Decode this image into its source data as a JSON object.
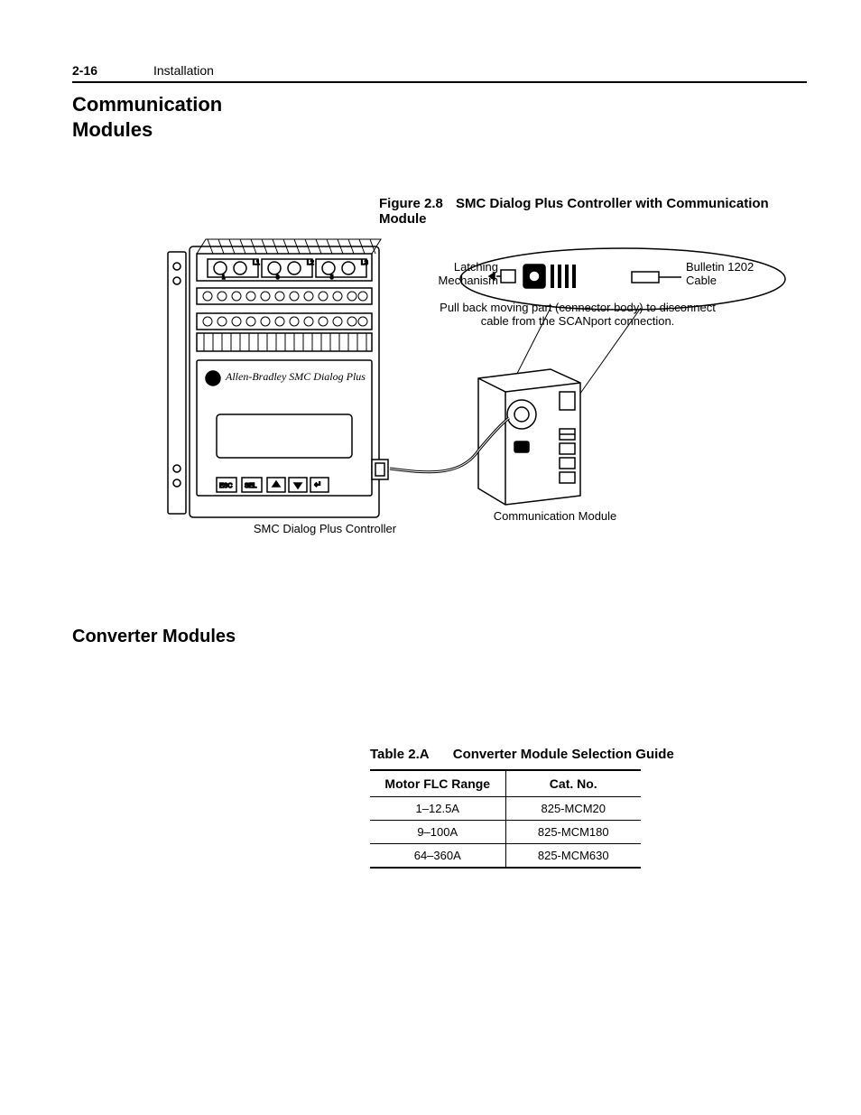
{
  "header": {
    "page_number": "2-16",
    "chapter": "Installation"
  },
  "sections": {
    "comm_modules": "Communication\nModules",
    "converter_modules": "Converter Modules"
  },
  "figure": {
    "number": "Figure 2.8",
    "title": "SMC Dialog Plus Controller with Communication Module",
    "labels": {
      "latching": "Latching\nMechanism",
      "bulletin_cable": "Bulletin 1202\nCable",
      "pull_back": "Pull back moving part (connector body) to disconnect\ncable from the SCANport connection.",
      "smc_controller": "SMC Dialog Plus Controller",
      "comm_module": "Communication Module",
      "device_label": "Allen-Bradley  SMC Dialog Plus"
    }
  },
  "table": {
    "number": "Table 2.A",
    "title": "Converter Module Selection Guide",
    "columns": {
      "col1": "Motor FLC Range",
      "col2": "Cat. No."
    },
    "rows": [
      {
        "range": "1–12.5A",
        "cat": "825-MCM20"
      },
      {
        "range": "9–100A",
        "cat": "825-MCM180"
      },
      {
        "range": "64–360A",
        "cat": "825-MCM630"
      }
    ]
  }
}
